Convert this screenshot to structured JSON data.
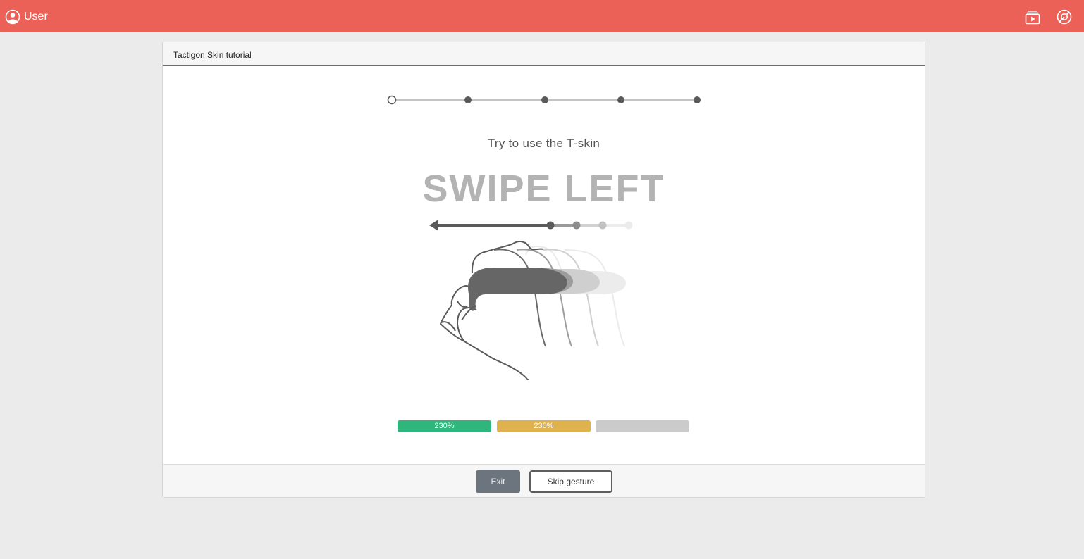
{
  "topbar": {
    "user_label": "User",
    "icons": [
      "user-icon",
      "video-tutorial-icon",
      "support-icon"
    ],
    "color": "#eb6157"
  },
  "modal": {
    "title": "Tactigon Skin tutorial",
    "stepper": {
      "total_steps": 5,
      "current_step": 1
    },
    "subtitle": "Try to use the T-skin",
    "gesture": "SWIPE LEFT",
    "progress": [
      {
        "label": "230%",
        "color": "#2eb67d"
      },
      {
        "label": "230%",
        "color": "#e0b24e"
      },
      {
        "label": "",
        "color": "#cbcbcb"
      }
    ]
  },
  "footer": {
    "exit_label": "Exit",
    "skip_label": "Skip gesture"
  }
}
